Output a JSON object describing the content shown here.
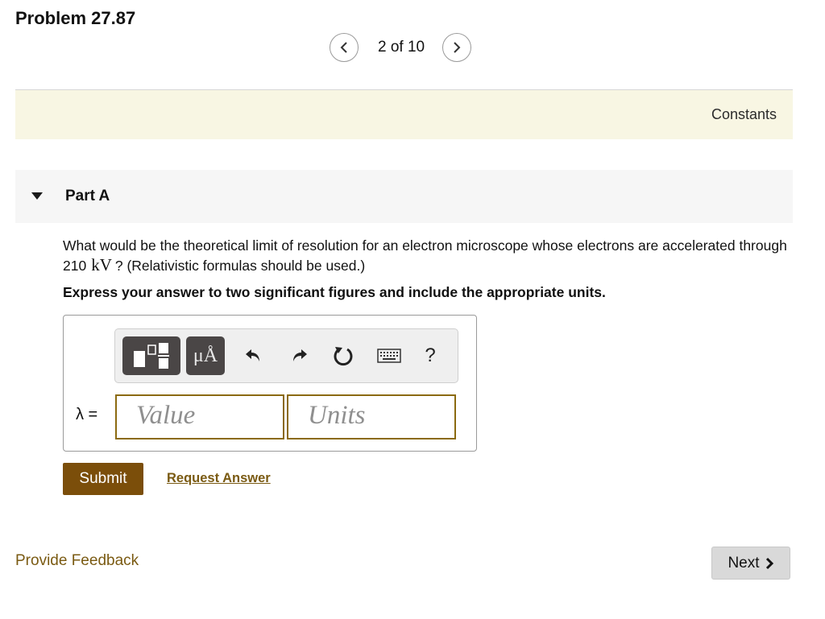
{
  "problem": {
    "title": "Problem 27.87"
  },
  "pager": {
    "text": "2 of 10",
    "prev_icon": "chevron-left-icon",
    "next_icon": "chevron-right-icon"
  },
  "constants": {
    "label": "Constants"
  },
  "part": {
    "label": "Part A"
  },
  "question": {
    "text_before": "What would be the theoretical limit of resolution for an electron microscope whose electrons are accelerated through 210",
    "unit": "kV",
    "text_after": "? (Relativistic formulas should be used.)"
  },
  "instruction": "Express your answer to two significant figures and include the appropriate units.",
  "toolbar": {
    "units_label": "μÅ",
    "help_label": "?",
    "icons": [
      "templates-icon",
      "units-icon",
      "undo-icon",
      "redo-icon",
      "reset-icon",
      "keyboard-icon",
      "help-icon"
    ]
  },
  "answer": {
    "variable_label": "λ =",
    "value_placeholder": "Value",
    "units_placeholder": "Units"
  },
  "actions": {
    "submit_label": "Submit",
    "request_answer_label": "Request Answer"
  },
  "footer": {
    "feedback_label": "Provide Feedback",
    "next_label": "Next"
  },
  "colors": {
    "accent_brown": "#7b4e0a",
    "link_brown": "#7a5a12",
    "constants_bg": "#f8f6e3",
    "part_bg": "#f6f6f6",
    "toolbar_dark": "#4a4646"
  }
}
